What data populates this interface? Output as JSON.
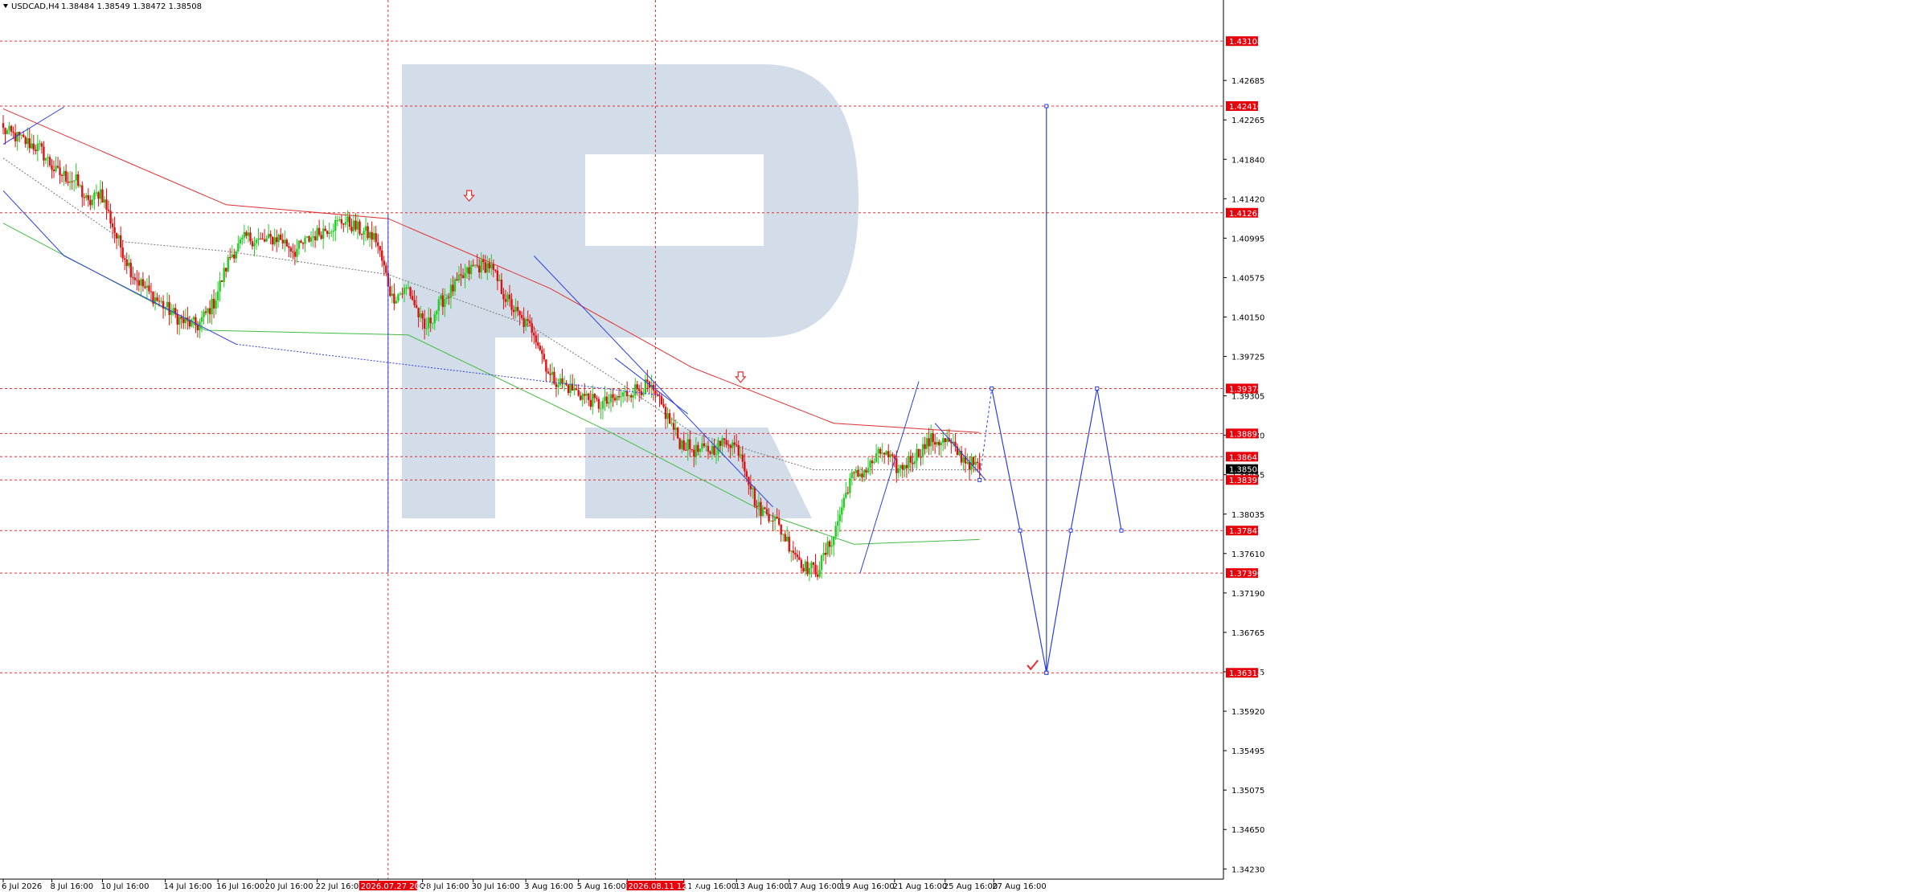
{
  "header": {
    "symbol_text": "USDCAD,H4",
    "ohlc_text": "1.38484 1.38549 1.38472 1.38508"
  },
  "colors": {
    "up_candle": "#22cc22",
    "down_candle": "#dd1111",
    "level_line": "#e03030",
    "price_tag_bg": "#e8000b",
    "current_tag_bg": "#000000",
    "wave_line": "#2b3fe0",
    "ma_slow": "#e03030",
    "ma_fast": "#44bb44",
    "ma_mid": "#777777",
    "watermark": "#d3dde9",
    "axis_text": "#000000"
  },
  "chart_data": {
    "type": "candlestick",
    "symbol": "USDCAD",
    "timeframe": "H4",
    "ylim": [
      1.34,
      1.4355
    ],
    "y_ticks": [
      "1.42685",
      "1.42265",
      "1.41840",
      "1.41420",
      "1.40995",
      "1.40575",
      "1.40150",
      "1.39725",
      "1.39305",
      "1.38880",
      "1.38455",
      "1.38035",
      "1.37610",
      "1.37190",
      "1.36765",
      "1.36345",
      "1.35920",
      "1.35495",
      "1.35075",
      "1.34650",
      "1.34230"
    ],
    "x_ticks": [
      "6 Jul 2026",
      "8 Jul 16:00",
      "10 Jul 16:00",
      "14 Jul 16:00",
      "16 Jul 16:00",
      "20 Jul 16:00",
      "22 Jul 16:00",
      "26 Jul 16:00",
      "28 Jul 16:00",
      "30 Jul 16:00",
      "3 Aug 16:00",
      "5 Aug 16:00",
      "7 Aug 16:00",
      "11 Aug 16:00",
      "13 Aug 16:00",
      "17 Aug 16:00",
      "19 Aug 16:00",
      "21 Aug 16:00",
      "25 Aug 16:00",
      "27 Aug 16:00"
    ],
    "levels": [
      {
        "value": 1.43108,
        "label": "1.43108"
      },
      {
        "value": 1.4241,
        "label": "1.42410"
      },
      {
        "value": 1.41263,
        "label": "1.41263"
      },
      {
        "value": 1.39374,
        "label": "1.39374"
      },
      {
        "value": 1.38891,
        "label": "1.38891"
      },
      {
        "value": 1.38641,
        "label": "1.38641"
      },
      {
        "value": 1.38391,
        "label": "1.38391"
      },
      {
        "value": 1.37847,
        "label": "1.37847"
      },
      {
        "value": 1.3739,
        "label": "1.37390"
      },
      {
        "value": 1.36318,
        "label": "1.36318"
      }
    ],
    "current_price": {
      "value": 1.38508,
      "label": "1.38508"
    },
    "crosshair_labels": [
      "2026.07.27 20:00",
      "2026.08.11 12:00"
    ],
    "close_path": [
      [
        0,
        1.4215
      ],
      [
        18,
        1.4195
      ],
      [
        26,
        1.417
      ],
      [
        36,
        1.416
      ],
      [
        42,
        1.4135
      ],
      [
        48,
        1.415
      ],
      [
        56,
        1.41
      ],
      [
        64,
        1.406
      ],
      [
        72,
        1.404
      ],
      [
        80,
        1.4025
      ],
      [
        88,
        1.401
      ],
      [
        96,
        1.4005
      ],
      [
        104,
        1.403
      ],
      [
        112,
        1.408
      ],
      [
        120,
        1.41
      ],
      [
        128,
        1.4095
      ],
      [
        136,
        1.41
      ],
      [
        144,
        1.4085
      ],
      [
        152,
        1.41
      ],
      [
        160,
        1.411
      ],
      [
        168,
        1.4118
      ],
      [
        176,
        1.4108
      ],
      [
        184,
        1.4098
      ],
      [
        192,
        1.4035
      ],
      [
        200,
        1.4045
      ],
      [
        208,
        1.4
      ],
      [
        216,
        1.403
      ],
      [
        224,
        1.405
      ],
      [
        232,
        1.4068
      ],
      [
        240,
        1.407
      ],
      [
        248,
        1.4035
      ],
      [
        256,
        1.401
      ],
      [
        262,
        1.4
      ],
      [
        270,
        1.395
      ],
      [
        278,
        1.394
      ],
      [
        286,
        1.393
      ],
      [
        294,
        1.392
      ],
      [
        302,
        1.3925
      ],
      [
        310,
        1.3935
      ],
      [
        318,
        1.394
      ],
      [
        326,
        1.3915
      ],
      [
        334,
        1.388
      ],
      [
        342,
        1.387
      ],
      [
        350,
        1.3872
      ],
      [
        358,
        1.3882
      ],
      [
        364,
        1.387
      ],
      [
        372,
        1.381
      ],
      [
        380,
        1.38
      ],
      [
        388,
        1.377
      ],
      [
        396,
        1.3745
      ],
      [
        402,
        1.3742
      ],
      [
        410,
        1.378
      ],
      [
        418,
        1.384
      ],
      [
        426,
        1.385
      ],
      [
        434,
        1.387
      ],
      [
        442,
        1.385
      ],
      [
        450,
        1.3865
      ],
      [
        458,
        1.3882
      ],
      [
        466,
        1.388
      ],
      [
        474,
        1.3862
      ],
      [
        482,
        1.3851
      ]
    ],
    "moving_averages": [
      {
        "name": "slow",
        "points": [
          [
            0,
            1.4238
          ],
          [
            110,
            1.4135
          ],
          [
            190,
            1.412
          ],
          [
            270,
            1.4045
          ],
          [
            340,
            1.396
          ],
          [
            410,
            1.39
          ],
          [
            482,
            1.389
          ]
        ]
      },
      {
        "name": "fast",
        "points": [
          [
            0,
            1.4115
          ],
          [
            100,
            1.4
          ],
          [
            200,
            1.3995
          ],
          [
            300,
            1.389
          ],
          [
            380,
            1.38
          ],
          [
            420,
            1.377
          ],
          [
            482,
            1.3775
          ]
        ]
      },
      {
        "name": "mid",
        "points": [
          [
            0,
            1.4185
          ],
          [
            60,
            1.4095
          ],
          [
            110,
            1.4085
          ],
          [
            190,
            1.406
          ],
          [
            260,
            1.4005
          ],
          [
            300,
            1.395
          ],
          [
            340,
            1.389
          ],
          [
            400,
            1.385
          ],
          [
            482,
            1.385
          ]
        ]
      }
    ],
    "forecast_path": [
      {
        "bar": 482,
        "value": 1.3839
      },
      {
        "bar": 488,
        "value": 1.39374
      },
      {
        "bar": 502,
        "value": 1.37847
      },
      {
        "bar": 515,
        "value": 1.36318
      },
      {
        "bar": 515,
        "value": 1.4241
      },
      {
        "bar": 515,
        "value": 1.36318
      },
      {
        "bar": 527,
        "value": 1.37847
      },
      {
        "bar": 540,
        "value": 1.39374
      },
      {
        "bar": 552,
        "value": 1.37847
      }
    ],
    "markers": [
      {
        "type": "arrow-down",
        "bar": 230,
        "value": 1.4145
      },
      {
        "type": "arrow-down",
        "bar": 364,
        "value": 1.395
      },
      {
        "type": "check",
        "bar": 508,
        "value": 1.364
      }
    ]
  }
}
